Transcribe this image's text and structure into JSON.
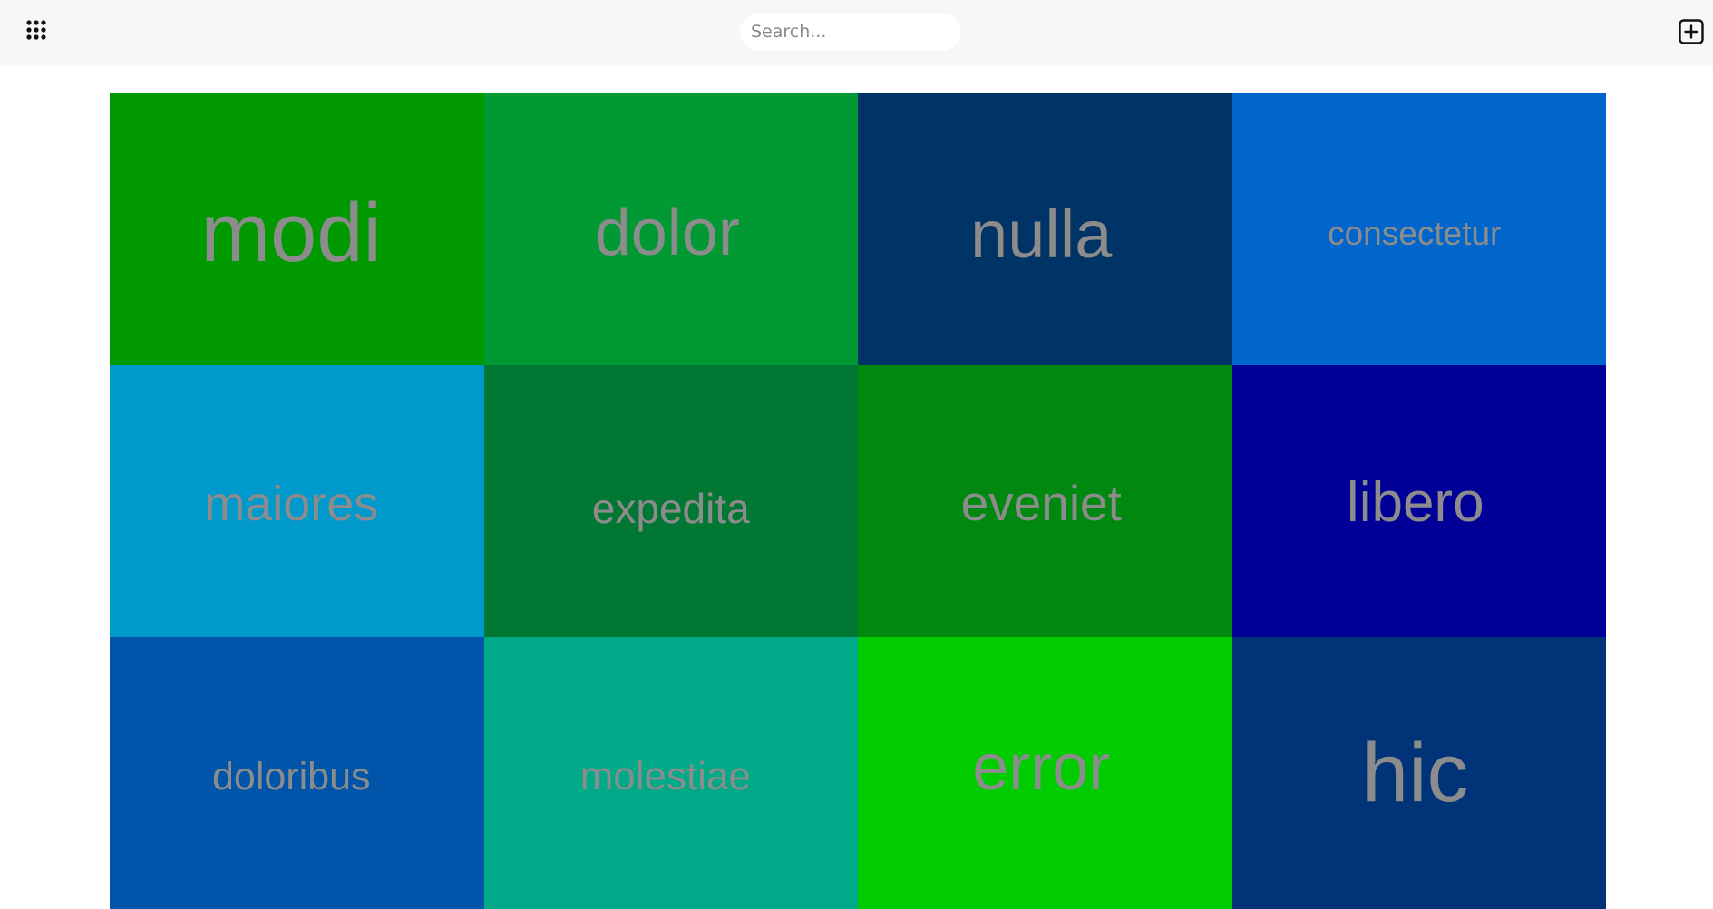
{
  "header": {
    "apps_icon": "apps-grid-icon",
    "search": {
      "placeholder": "Search...",
      "value": ""
    },
    "add_icon": "plus-square-icon"
  },
  "tiles": [
    {
      "label": "modi",
      "color": "#009900"
    },
    {
      "label": "dolor",
      "color": "#009933"
    },
    {
      "label": "nulla",
      "color": "#003366"
    },
    {
      "label": "consectetur",
      "color": "#0066cc"
    },
    {
      "label": "maiores",
      "color": "#0099cc"
    },
    {
      "label": "expedita",
      "color": "#007733"
    },
    {
      "label": "eveniet",
      "color": "#008811"
    },
    {
      "label": "libero",
      "color": "#000099"
    },
    {
      "label": "doloribus",
      "color": "#0055aa"
    },
    {
      "label": "molestiae",
      "color": "#00aa88"
    },
    {
      "label": "error",
      "color": "#00cc00"
    },
    {
      "label": "hic",
      "color": "#003377"
    }
  ]
}
